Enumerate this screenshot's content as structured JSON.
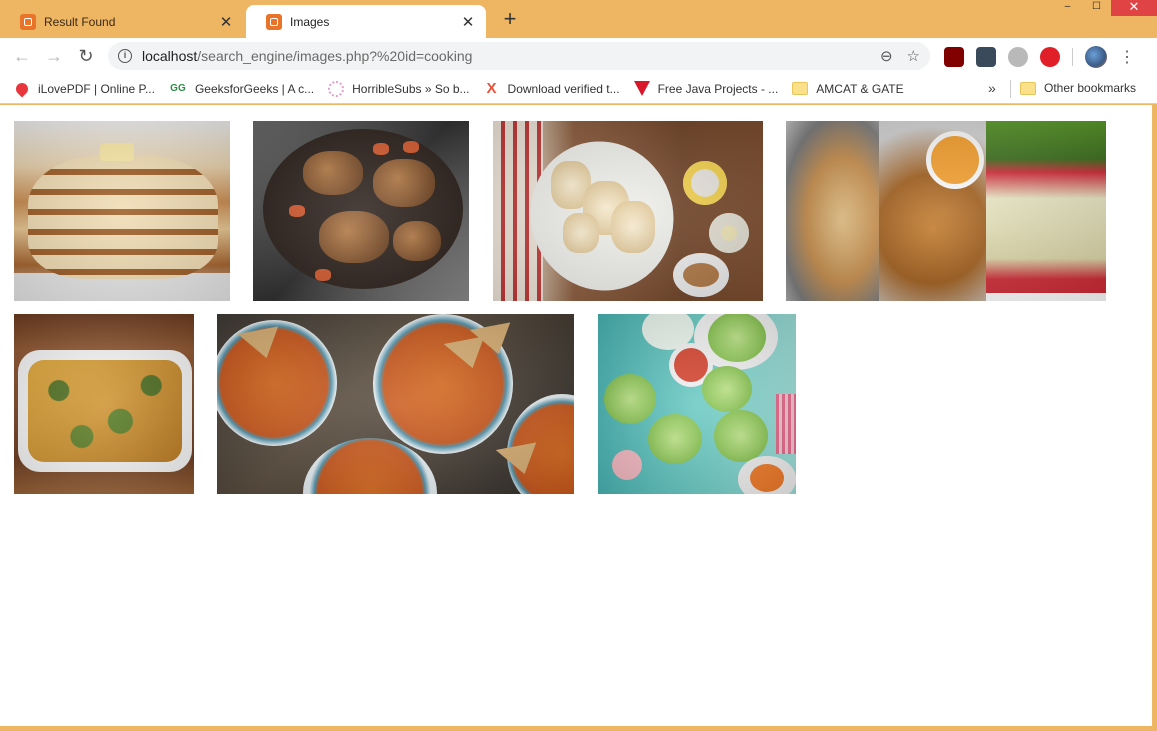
{
  "tabs": [
    {
      "title": "Result Found",
      "active": false
    },
    {
      "title": "Images",
      "active": true
    }
  ],
  "window_controls": {
    "minimize": "–",
    "maximize": "☐",
    "close": "✕"
  },
  "address_bar": {
    "host": "localhost",
    "path": "/search_engine/images.php?%20id=cooking"
  },
  "bookmarks": [
    {
      "label": "iLovePDF | Online P...",
      "icon": "heart-icon"
    },
    {
      "label": "GeeksforGeeks | A c...",
      "icon": "gfg-icon"
    },
    {
      "label": "HorribleSubs » So b...",
      "icon": "flower-icon"
    },
    {
      "label": "Download verified t...",
      "icon": "x-icon"
    },
    {
      "label": "Free Java Projects - ...",
      "icon": "triangle-icon"
    },
    {
      "label": "AMCAT & GATE",
      "icon": "folder-icon"
    }
  ],
  "bookmarks_more": "»",
  "other_bookmarks": "Other bookmarks",
  "images": [
    {
      "subject": "pancakes"
    },
    {
      "subject": "braised chicken"
    },
    {
      "subject": "roasted cauliflower"
    },
    {
      "subject": "chicken collage"
    },
    {
      "subject": "broccoli casserole"
    },
    {
      "subject": "pumpkin soup"
    },
    {
      "subject": "lettuce wraps"
    }
  ],
  "colors": {
    "frame": "#eeb563",
    "tab_active": "#ffffff",
    "close_button": "#e04343"
  }
}
